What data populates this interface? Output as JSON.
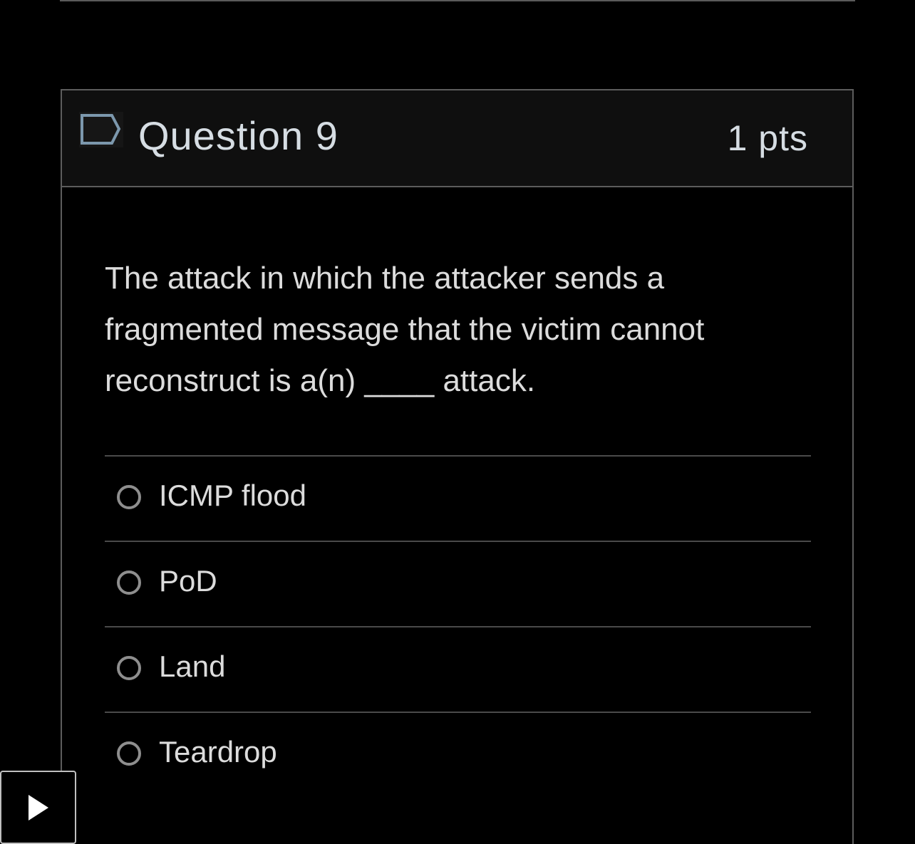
{
  "question": {
    "title": "Question 9",
    "points": "1 pts",
    "flag_icon": "flag-outline-icon",
    "text": "The attack in which the attacker sends a fragmented message that the victim cannot reconstruct is a(n) ____ attack."
  },
  "answers": [
    {
      "label": "ICMP flood",
      "selected": false
    },
    {
      "label": "PoD",
      "selected": false
    },
    {
      "label": "Land",
      "selected": false
    },
    {
      "label": "Teardrop",
      "selected": false
    }
  ],
  "media": {
    "play_icon": "play-icon"
  },
  "colors": {
    "background": "#000000",
    "header_background": "#0f0f0f",
    "border": "#5c5c5c",
    "text": "#dcdcdc",
    "radio_border": "#8e8e8e"
  }
}
